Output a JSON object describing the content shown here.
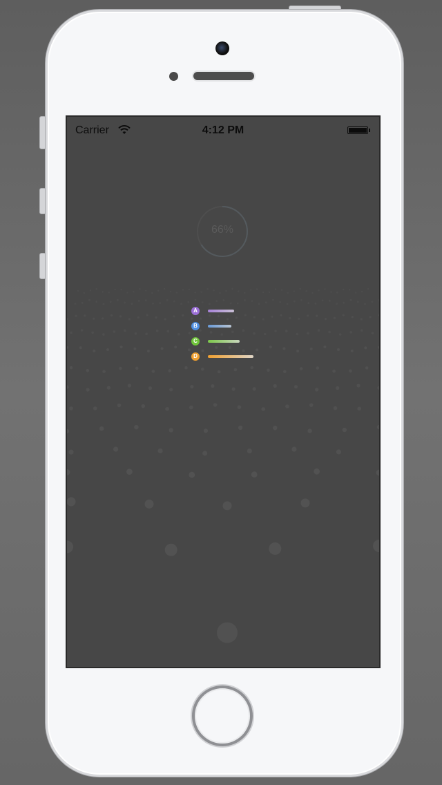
{
  "status_bar": {
    "carrier": "Carrier",
    "time": "4:12 PM",
    "wifi_icon": "wifi-icon",
    "battery_icon": "battery-icon",
    "battery_level": 1.0
  },
  "progress": {
    "label": "66%",
    "value": 0.66
  },
  "choices": [
    {
      "letter": "A",
      "color": "#9b6fd6",
      "bar_start": "#a782d8",
      "bar_end": "#c9c0d6",
      "fill": 0.4
    },
    {
      "letter": "B",
      "color": "#4f8fe0",
      "bar_start": "#6a9bd8",
      "bar_end": "#b8c4d2",
      "fill": 0.36
    },
    {
      "letter": "C",
      "color": "#6fc43a",
      "bar_start": "#7cc84a",
      "bar_end": "#c9d6bd",
      "fill": 0.49
    },
    {
      "letter": "D",
      "color": "#f0a030",
      "bar_start": "#f0a030",
      "bar_end": "#e0d6c8",
      "fill": 0.7
    }
  ],
  "colors": {
    "screen_bg": "#474747",
    "device_body": "#f6f7f9",
    "particle": "#5a5a5a"
  }
}
